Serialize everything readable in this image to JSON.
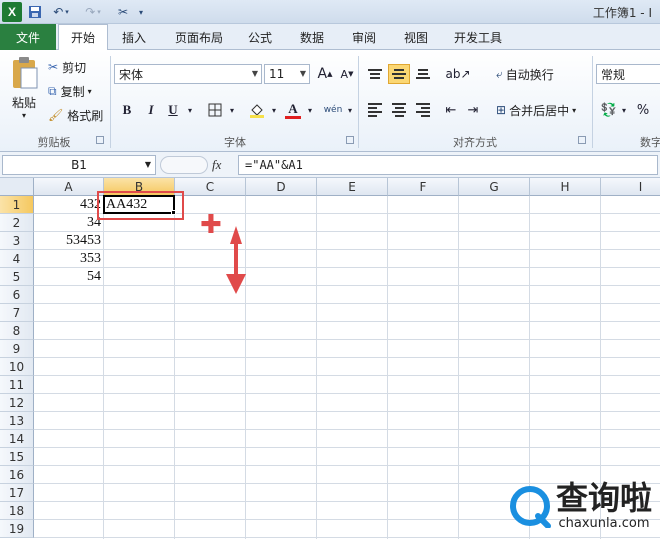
{
  "titlebar": {
    "app_icon": "X",
    "window_title": "工作簿1 - I"
  },
  "tabs": {
    "file": "文件",
    "items": [
      "开始",
      "插入",
      "页面布局",
      "公式",
      "数据",
      "审阅",
      "视图",
      "开发工具"
    ],
    "active": "开始"
  },
  "clipboard": {
    "paste": "粘贴",
    "cut": "剪切",
    "copy": "复制",
    "format_painter": "格式刷",
    "group_label": "剪贴板"
  },
  "font": {
    "name": "宋体",
    "size": "11",
    "grow": "A",
    "shrink": "A",
    "bold": "B",
    "italic": "I",
    "underline": "U",
    "color_glyph": "A",
    "phonetic": "wén",
    "group_label": "字体"
  },
  "alignment": {
    "wrap_text": "自动换行",
    "merge_center": "合并后居中",
    "group_label": "对齐方式"
  },
  "number": {
    "format": "常规",
    "percent": "%",
    "group_label": "数字"
  },
  "formula_bar": {
    "name_box": "B1",
    "fx": "fx",
    "formula": "=\"AA\"&A1"
  },
  "grid": {
    "columns": [
      "A",
      "B",
      "C",
      "D",
      "E",
      "F",
      "G",
      "H",
      "I"
    ],
    "rows": [
      "1",
      "2",
      "3",
      "4",
      "5",
      "6",
      "7",
      "8",
      "9",
      "10",
      "11",
      "12",
      "13",
      "14",
      "15",
      "16",
      "17",
      "18",
      "19"
    ],
    "column_a": [
      "432",
      "34",
      "53453",
      "353",
      "54"
    ],
    "b1": "AA432",
    "selected_cell": "B1"
  },
  "annotations": {
    "plus_glyph": "✚",
    "arrow_color": "#e04a4a"
  },
  "watermark": {
    "text": "查询啦",
    "url": "chaxunla.com"
  },
  "colors": {
    "file_tab": "#2a8040",
    "accent_blue": "#1a8fe0",
    "header_selected": "#f5c85f"
  }
}
